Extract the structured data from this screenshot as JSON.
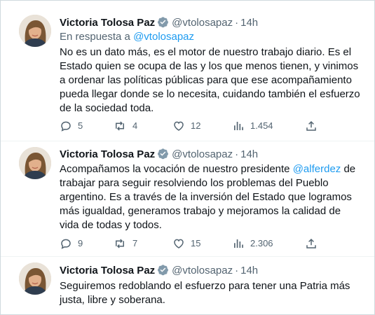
{
  "colors": {
    "accent": "#1d9bf0",
    "muted": "#536471",
    "text": "#0f1419",
    "verified": "#829aab"
  },
  "tweets": [
    {
      "name": "Victoria Tolosa Paz",
      "handle": "@vtolosapaz",
      "dot": "·",
      "time": "14h",
      "reply_prefix": "En respuesta a",
      "reply_handle": "@vtolosapaz",
      "text": "No es un dato más, es el motor de nuestro trabajo diario. Es el Estado quien se ocupa de las y los que menos tienen, y vinimos a ordenar las políticas públicas para que ese acompañamiento pueda llegar donde se lo necesita, cuidando también el esfuerzo de la sociedad toda.",
      "replies": "5",
      "retweets": "4",
      "likes": "12",
      "views": "1.454"
    },
    {
      "name": "Victoria Tolosa Paz",
      "handle": "@vtolosapaz",
      "dot": "·",
      "time": "14h",
      "text_before": "Acompañamos la vocación de nuestro presidente ",
      "mention": "@alferdez",
      "text_after": " de trabajar para seguir resolviendo los problemas del Pueblo argentino. Es a través de la inversión del Estado que logramos más igualdad, generamos trabajo y mejoramos la calidad de vida de todas y todos.",
      "replies": "9",
      "retweets": "7",
      "likes": "15",
      "views": "2.306"
    },
    {
      "name": "Victoria Tolosa Paz",
      "handle": "@vtolosapaz",
      "dot": "·",
      "time": "14h",
      "text": "Seguiremos redoblando el esfuerzo para tener una Patria más justa, libre y soberana."
    }
  ]
}
